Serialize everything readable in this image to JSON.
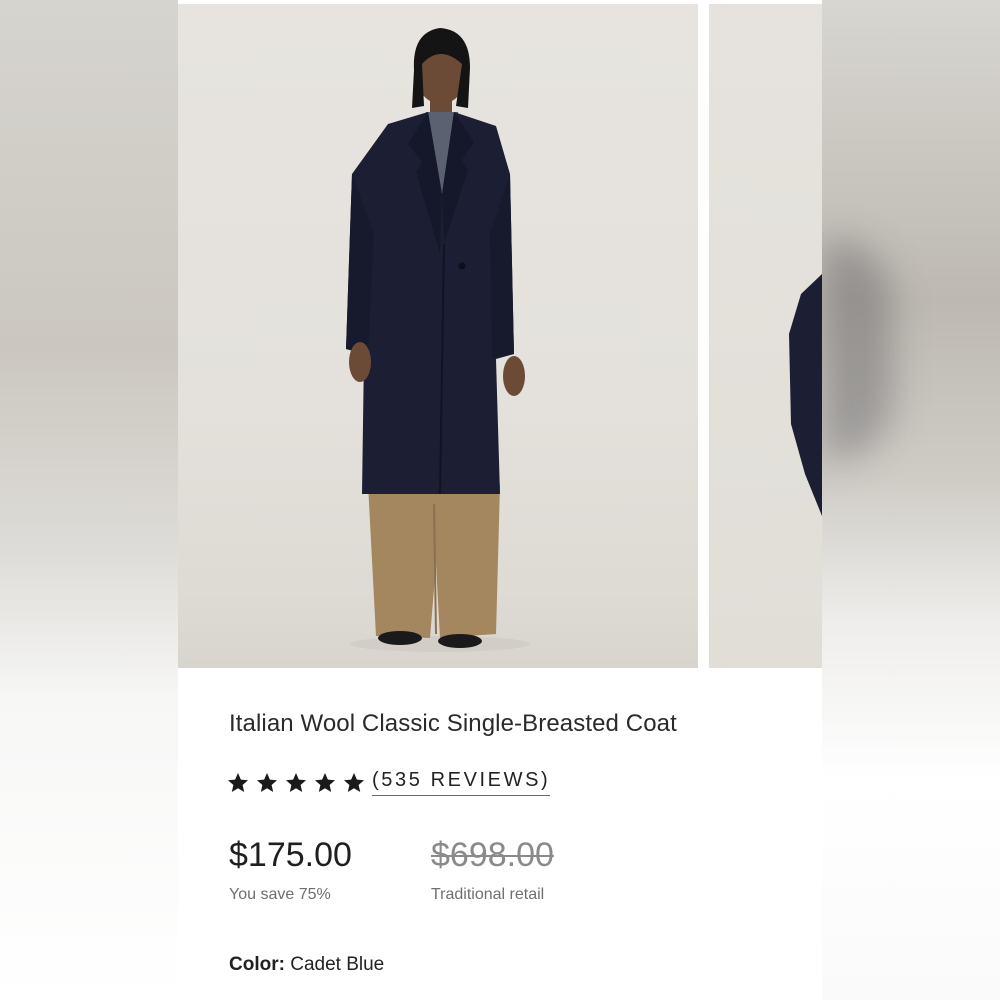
{
  "product": {
    "title": "Italian Wool Classic Single-Breasted Coat",
    "rating_stars": 5,
    "reviews_label": "(535 REVIEWS)",
    "price": "$175.00",
    "savings": "You save 75%",
    "retail_price": "$698.00",
    "retail_label": "Traditional retail",
    "color_label": "Color:",
    "color_value": "Cadet Blue"
  },
  "colors": {
    "coat": "#1c1f33",
    "trousers": "#a4865f",
    "background": "#e6e3de",
    "star": "#1a1a1a"
  }
}
